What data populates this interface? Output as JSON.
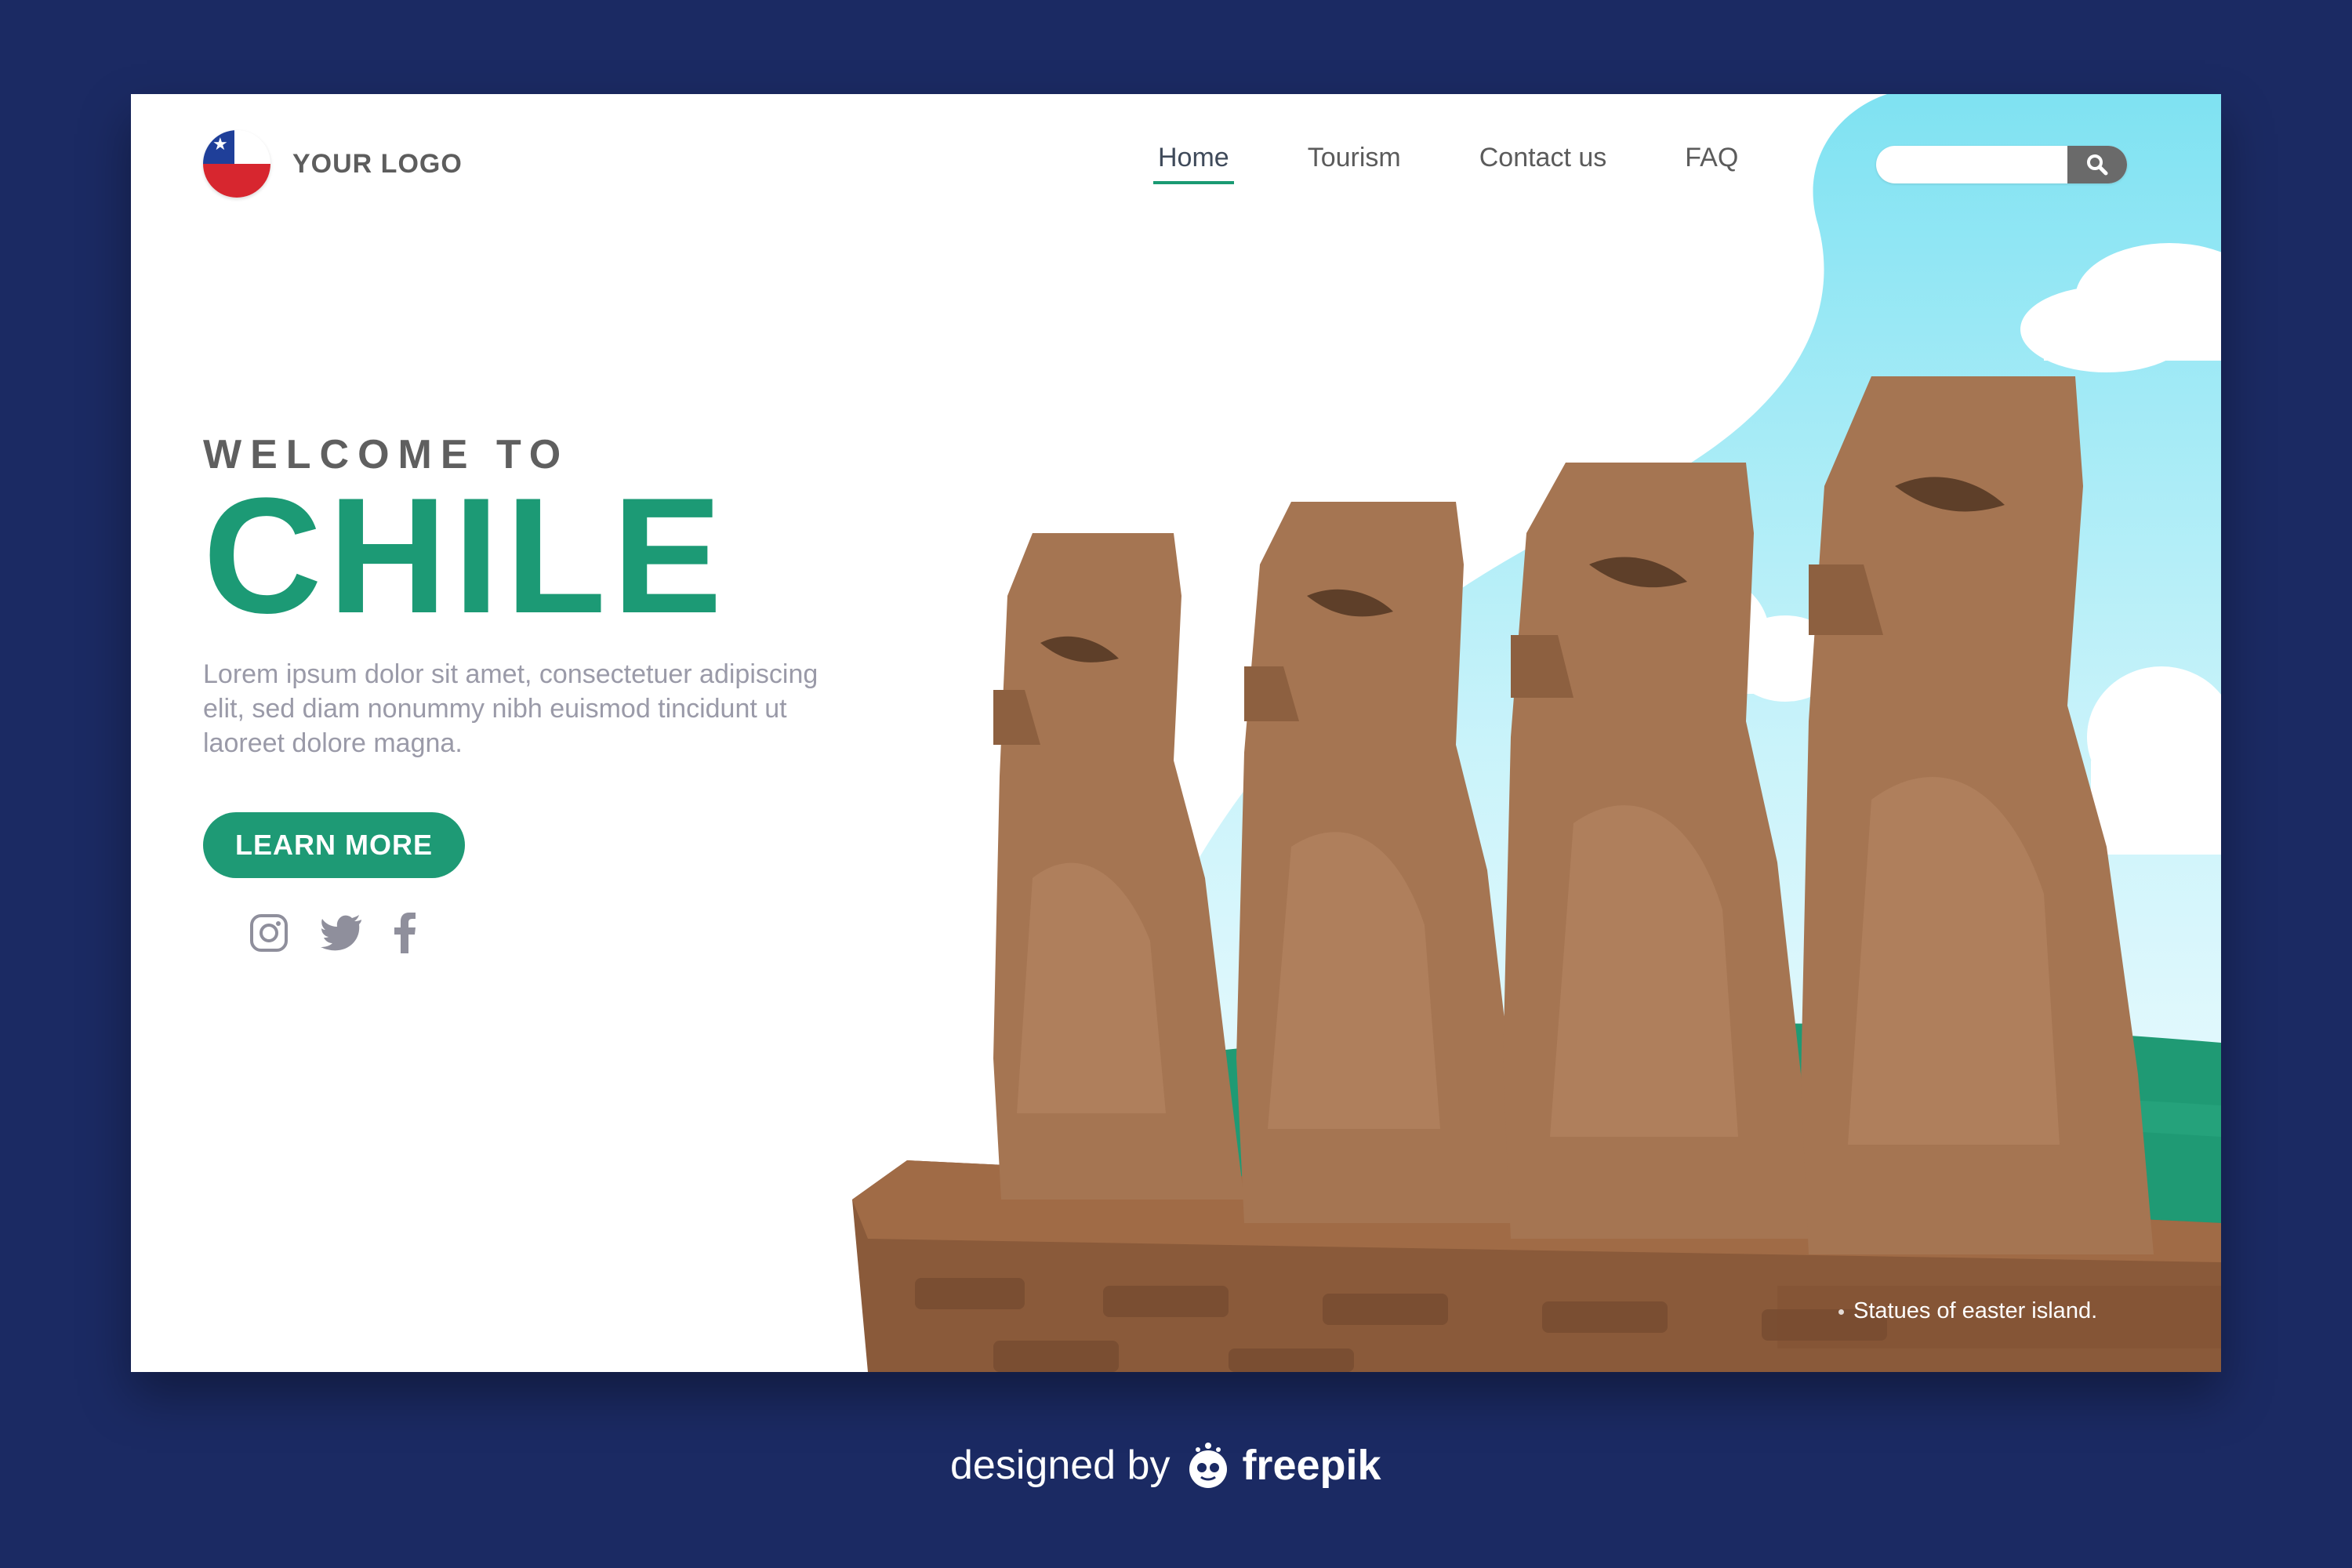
{
  "brand": {
    "logo_text": "YOUR LOGO",
    "flag_icon": "chile-flag-icon"
  },
  "nav": {
    "items": [
      {
        "label": "Home",
        "active": true
      },
      {
        "label": "Tourism",
        "active": false
      },
      {
        "label": "Contact us",
        "active": false
      },
      {
        "label": "FAQ",
        "active": false
      }
    ]
  },
  "search": {
    "placeholder": "",
    "button_icon": "search-icon"
  },
  "hero": {
    "welcome": "WELCOME TO",
    "title": "CHILE",
    "description": "Lorem ipsum dolor sit amet, consectetuer adipiscing elit, sed diam nonummy nibh euismod tincidunt ut laoreet dolore magna.",
    "button_label": "LEARN MORE"
  },
  "social": [
    "instagram-icon",
    "twitter-icon",
    "facebook-icon"
  ],
  "caption": "Statues of easter island.",
  "credit": {
    "prefix": "designed by",
    "brand": "freepik"
  },
  "colors": {
    "background": "#1b2a63",
    "accent": "#1c9a75",
    "sky": "#9fe8f5",
    "statue": "#a57552"
  }
}
